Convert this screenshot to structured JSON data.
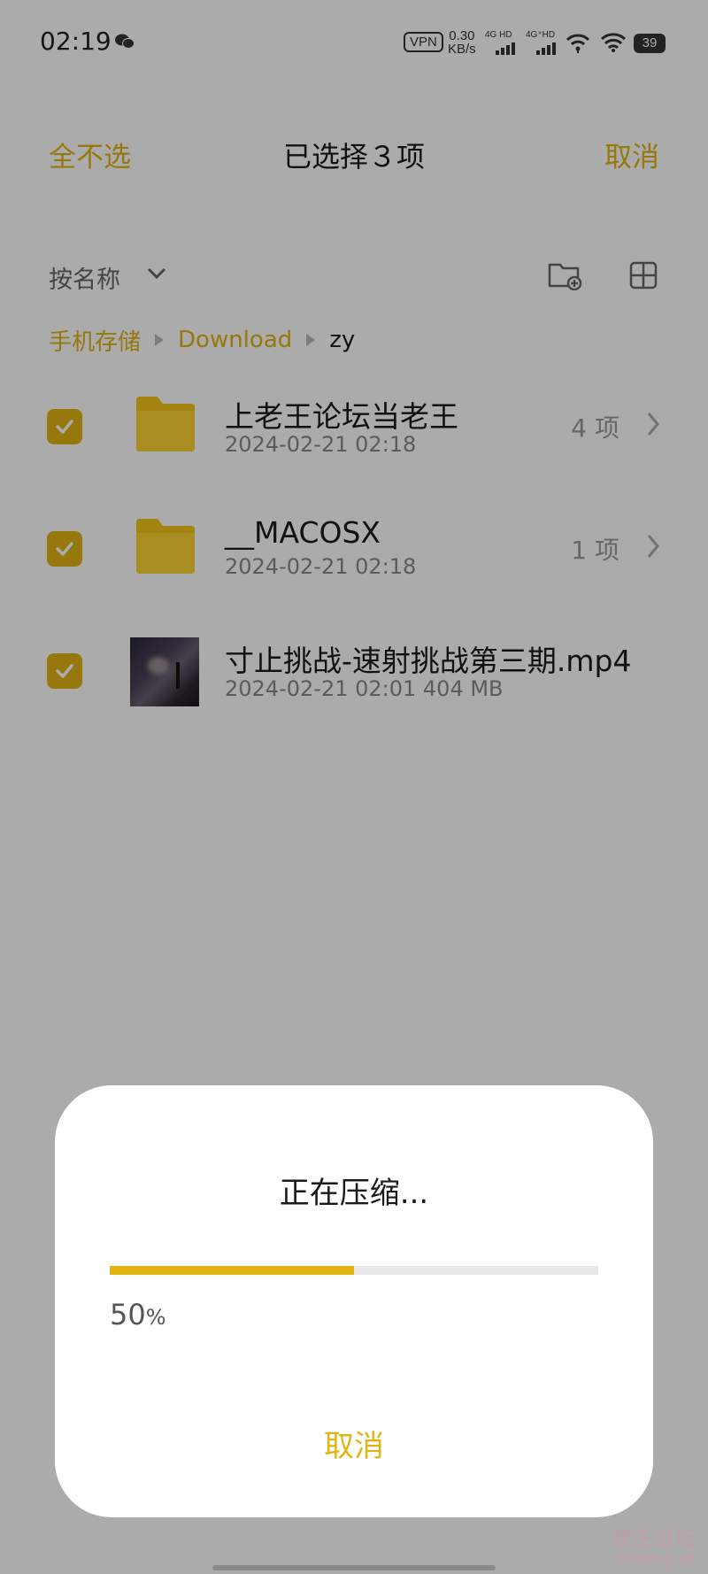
{
  "status_bar": {
    "time": "02:19",
    "vpn": "VPN",
    "speed_value": "0.30",
    "speed_unit": "KB/s",
    "sim1_label": "4G HD",
    "sim2_label": "4G⁺HD",
    "battery": "39",
    "icons": [
      "wechat-icon",
      "signal-icon",
      "wifi-icon",
      "battery-icon"
    ]
  },
  "action_bar": {
    "deselect_all": "全不选",
    "title": "已选择３项",
    "cancel": "取消"
  },
  "sort": {
    "label": "按名称",
    "icons": [
      "chevron-down-icon",
      "new-folder-icon",
      "grid-view-icon"
    ]
  },
  "breadcrumb": [
    "手机存储",
    "Download",
    "zy"
  ],
  "files": [
    {
      "name": "上老王论坛当老王",
      "meta": "2024-02-21 02:18",
      "count": "4 项",
      "type": "folder",
      "checked": true
    },
    {
      "name": "__MACOSX",
      "meta": "2024-02-21 02:18",
      "count": "1 项",
      "type": "folder",
      "checked": true
    },
    {
      "name": "寸止挑战-速射挑战第三期.mp4",
      "meta": "2024-02-21 02:01   404 MB",
      "count": "",
      "type": "video",
      "checked": true
    }
  ],
  "dialog": {
    "title": "正在压缩...",
    "progress_fraction": 0.5,
    "percent_number": "50",
    "percent_sign": "%",
    "cancel": "取消"
  },
  "watermark": {
    "line1": "老王论坛",
    "line2": "laowang.vip"
  },
  "colors": {
    "accent": "#e0b412",
    "scrim": "rgba(0,0,0,0.33)",
    "progress_track": "#e8e8e8"
  }
}
